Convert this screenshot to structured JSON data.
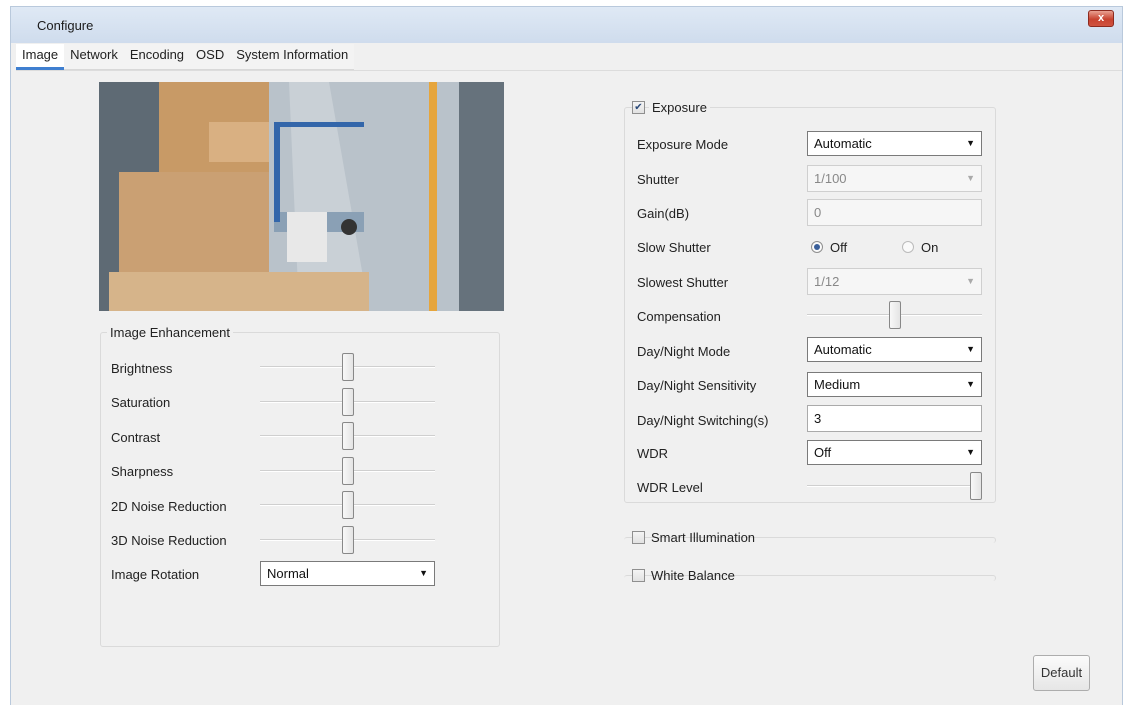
{
  "window": {
    "title": "Configure",
    "close_icon": "close-icon",
    "close_label": "x"
  },
  "tabs": [
    {
      "label": "Image",
      "active": true
    },
    {
      "label": "Network",
      "active": false
    },
    {
      "label": "Encoding",
      "active": false
    },
    {
      "label": "OSD",
      "active": false
    },
    {
      "label": "System Information",
      "active": false
    }
  ],
  "enhancement": {
    "title": "Image Enhancement",
    "brightness": {
      "label": "Brightness",
      "level": 50
    },
    "saturation": {
      "label": "Saturation",
      "level": 50
    },
    "contrast": {
      "label": "Contrast",
      "level": 50
    },
    "sharpness": {
      "label": "Sharpness",
      "level": 50
    },
    "noise2d": {
      "label": "2D Noise Reduction",
      "level": 50
    },
    "noise3d": {
      "label": "3D Noise Reduction",
      "level": 50
    },
    "rotation": {
      "label": "Image Rotation",
      "value": "Normal"
    }
  },
  "exposure": {
    "title": "Exposure",
    "checked": true,
    "mode": {
      "label": "Exposure Mode",
      "value": "Automatic"
    },
    "shutter": {
      "label": "Shutter",
      "value": "1/100"
    },
    "gain": {
      "label": "Gain(dB)",
      "value": "0"
    },
    "slow_shutter": {
      "label": "Slow Shutter",
      "off_label": "Off",
      "on_label": "On",
      "selected": "Off"
    },
    "slowest_shutter": {
      "label": "Slowest Shutter",
      "value": "1/12"
    },
    "compensation": {
      "label": "Compensation",
      "level": 50
    },
    "daynight_mode": {
      "label": "Day/Night Mode",
      "value": "Automatic"
    },
    "daynight_sensitivity": {
      "label": "Day/Night Sensitivity",
      "value": "Medium"
    },
    "daynight_switching": {
      "label": "Day/Night Switching(s)",
      "value": "3"
    },
    "wdr": {
      "label": "WDR",
      "value": "Off"
    },
    "wdr_level": {
      "label": "WDR Level",
      "level": 100
    }
  },
  "smart_illumination": {
    "label": "Smart Illumination",
    "checked": false
  },
  "white_balance": {
    "label": "White Balance",
    "checked": false
  },
  "buttons": {
    "default_label": "Default"
  },
  "icons": {
    "dropdown": "chevron-down-icon",
    "check": "check-icon"
  }
}
